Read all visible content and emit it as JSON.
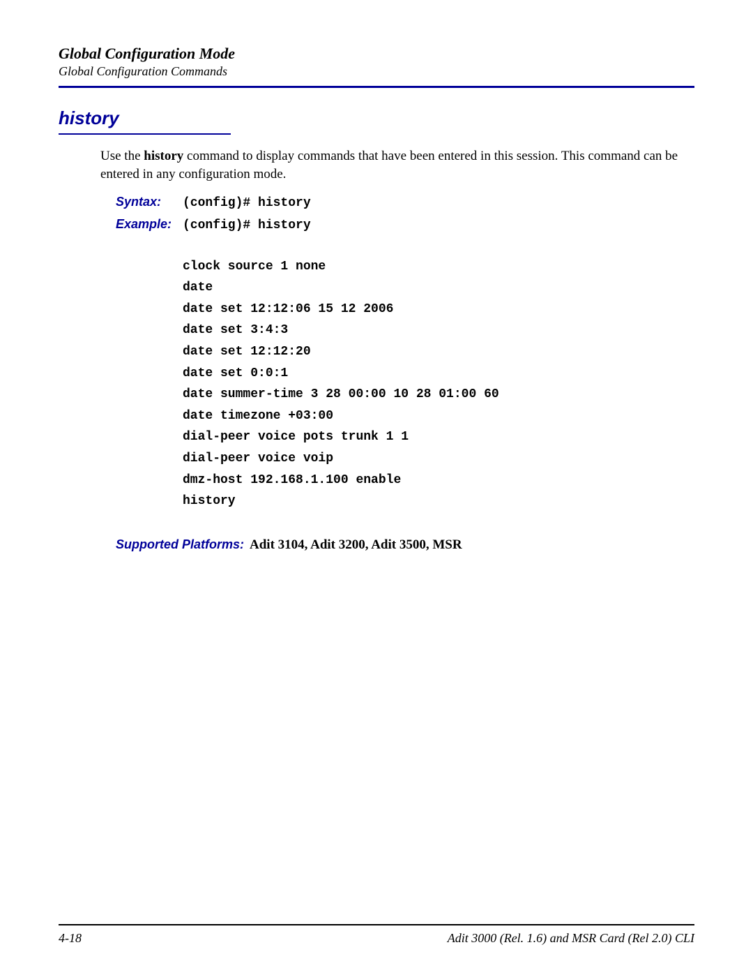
{
  "header": {
    "chapter_title": "Global Configuration Mode",
    "section_path": "Global Configuration Commands"
  },
  "command": {
    "name": "history",
    "description_pre": "Use the ",
    "description_bold": "history",
    "description_post": " command to display commands that have been entered in this session. This command can be entered in any configuration mode.",
    "syntax_label": "Syntax:",
    "syntax_value": "(config)# history",
    "example_label": "Example:",
    "example_value": "(config)# history",
    "output": [
      "clock source 1 none",
      "date",
      "date set 12:12:06 15 12 2006",
      "date set 3:4:3",
      "date set 12:12:20",
      "date set 0:0:1",
      "date summer-time 3 28 00:00 10 28 01:00 60",
      "date timezone +03:00",
      "dial-peer voice pots trunk 1 1",
      "dial-peer voice voip",
      "dmz-host 192.168.1.100 enable",
      "history"
    ],
    "supported_label": "Supported Platforms:",
    "supported_value": "Adit 3104, Adit 3200, Adit 3500, MSR"
  },
  "footer": {
    "page_number": "4-18",
    "doc_title": "Adit 3000 (Rel. 1.6) and MSR Card (Rel 2.0) CLI"
  }
}
